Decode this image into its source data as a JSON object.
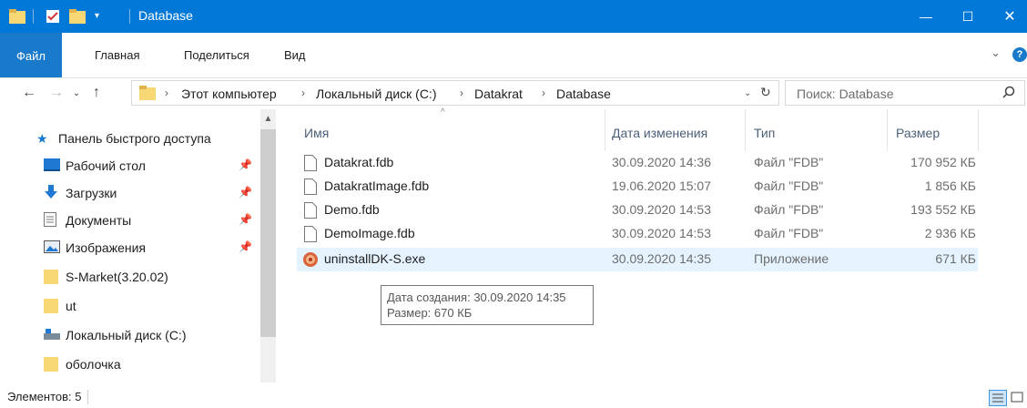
{
  "window": {
    "title": "Database",
    "minimize": "—",
    "maximize": "☐",
    "close": "✕"
  },
  "ribbon": {
    "tabs": [
      {
        "label": "Файл",
        "active": true
      },
      {
        "label": "Главная",
        "active": false
      },
      {
        "label": "Поделиться",
        "active": false
      },
      {
        "label": "Вид",
        "active": false
      }
    ],
    "expand": "⌄",
    "help": "?"
  },
  "address": {
    "breadcrumbs": [
      "Этот компьютер",
      "Локальный диск (C:)",
      "Datakrat",
      "Database"
    ],
    "search_placeholder": "Поиск: Database"
  },
  "sidebar": {
    "items": [
      {
        "label": "Панель быстрого доступа",
        "icon": "star-icon",
        "pinned": false
      },
      {
        "label": "Рабочий стол",
        "icon": "desktop-icon",
        "pinned": true
      },
      {
        "label": "Загрузки",
        "icon": "download-icon",
        "pinned": true
      },
      {
        "label": "Документы",
        "icon": "documents-icon",
        "pinned": true
      },
      {
        "label": "Изображения",
        "icon": "pictures-icon",
        "pinned": true
      },
      {
        "label": "S-Market(3.20.02)",
        "icon": "folder-icon",
        "pinned": false
      },
      {
        "label": "ut",
        "icon": "folder-icon",
        "pinned": false
      },
      {
        "label": "Локальный диск (C:)",
        "icon": "drive-icon",
        "pinned": false
      },
      {
        "label": "оболочка",
        "icon": "folder-icon",
        "pinned": false
      }
    ]
  },
  "filelist": {
    "columns": {
      "name": "Имя",
      "date": "Дата изменения",
      "type": "Тип",
      "size": "Размер"
    },
    "rows": [
      {
        "name": "Datakrat.fdb",
        "date": "30.09.2020 14:36",
        "type": "Файл \"FDB\"",
        "size": "170 952 КБ",
        "icon": "file-icon"
      },
      {
        "name": "DatakratImage.fdb",
        "date": "19.06.2020 15:07",
        "type": "Файл \"FDB\"",
        "size": "1 856 КБ",
        "icon": "file-icon"
      },
      {
        "name": "Demo.fdb",
        "date": "30.09.2020 14:53",
        "type": "Файл \"FDB\"",
        "size": "193 552 КБ",
        "icon": "file-icon"
      },
      {
        "name": "DemoImage.fdb",
        "date": "30.09.2020 14:53",
        "type": "Файл \"FDB\"",
        "size": "2 936 КБ",
        "icon": "file-icon"
      },
      {
        "name": "uninstallDK-S.exe",
        "date": "30.09.2020 14:35",
        "type": "Приложение",
        "size": "671 КБ",
        "icon": "uninstaller-icon"
      }
    ]
  },
  "tooltip": {
    "line1": "Дата создания: 30.09.2020 14:35",
    "line2": "Размер: 670 КБ"
  },
  "status": {
    "items_count": "Элементов: 5"
  },
  "colors": {
    "titlebar": "#0078d7",
    "selected_row": "#e5f3ff",
    "folder": "#f8d775"
  }
}
